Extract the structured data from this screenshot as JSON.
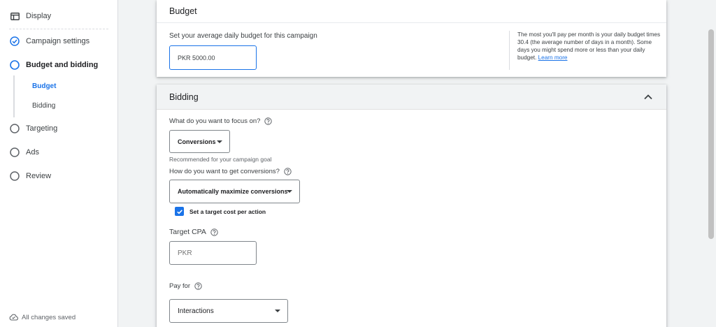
{
  "sidebar": {
    "items": [
      {
        "label": "Display",
        "icon": "display-window-icon"
      },
      {
        "label": "Campaign settings",
        "icon": "check-circle-icon"
      },
      {
        "label": "Budget and bidding",
        "icon": "circle-icon"
      },
      {
        "label": "Targeting",
        "icon": "circle-icon"
      },
      {
        "label": "Ads",
        "icon": "circle-icon"
      },
      {
        "label": "Review",
        "icon": "circle-icon"
      }
    ],
    "subitems": [
      {
        "label": "Budget",
        "active": true
      },
      {
        "label": "Bidding",
        "active": false
      }
    ],
    "footer": {
      "label": "All changes saved",
      "icon": "cloud-done-icon"
    }
  },
  "budget": {
    "title": "Budget",
    "label": "Set your average daily budget for this campaign",
    "value": "PKR 5000.00",
    "help_text": "The most you'll pay per month is your daily budget times 30.4 (the average number of days in a month). Some days you might spend more or less than your daily budget.",
    "learn_more": "Learn more"
  },
  "bidding": {
    "title": "Bidding",
    "focus_question": "What do you want to focus on?",
    "focus_value": "Conversions",
    "focus_hint": "Recommended for your campaign goal",
    "conversions_question": "How do you want to get conversions?",
    "conversions_value": "Automatically maximize conversions",
    "target_checkbox_label": "Set a target cost per action",
    "target_cpa_label": "Target CPA",
    "target_cpa_placeholder": "PKR",
    "pay_for_label": "Pay for",
    "pay_for_value": "Interactions"
  },
  "colors": {
    "accent": "#1a73e8",
    "text": "#3c4043",
    "muted": "#5f6368",
    "border": "#dadce0",
    "background": "#f1f3f4"
  }
}
